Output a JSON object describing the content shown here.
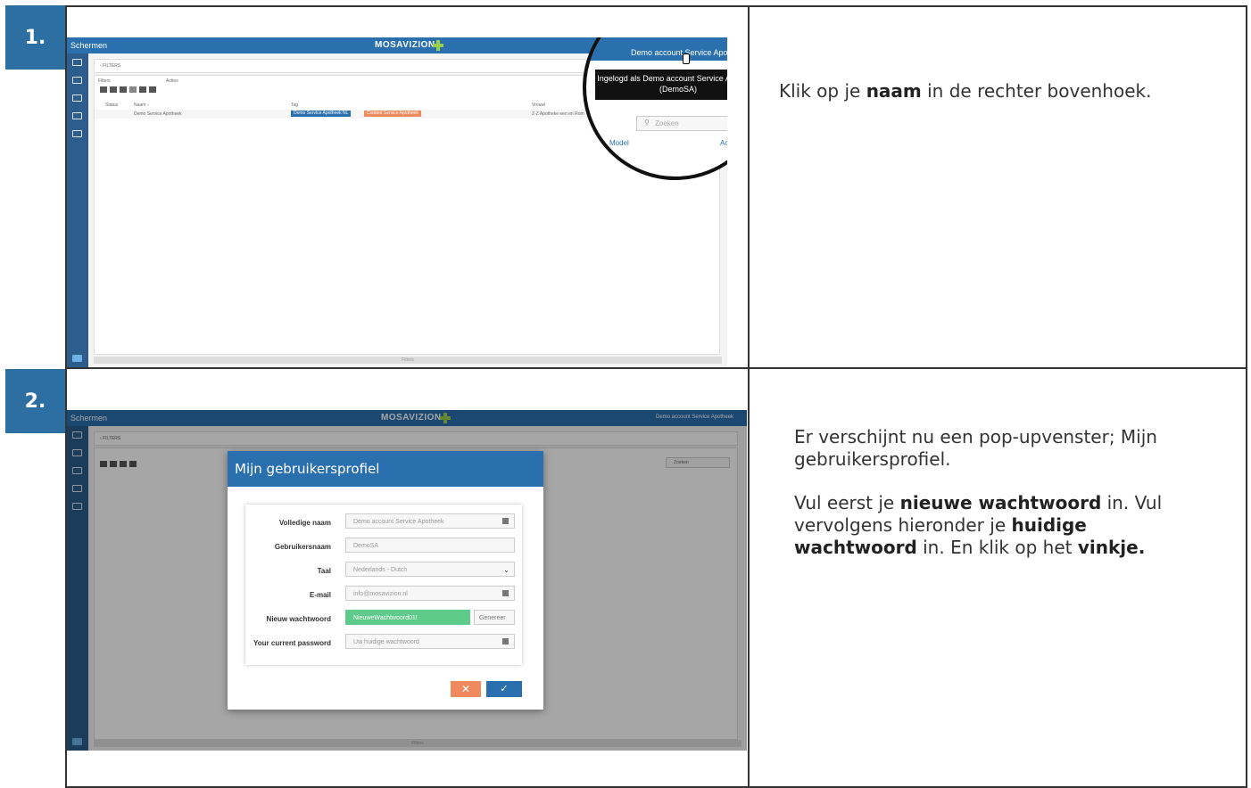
{
  "steps": [
    {
      "number": "1.",
      "description_parts": [
        {
          "text": "Klik op je ",
          "bold": false
        },
        {
          "text": "naam",
          "bold": true
        },
        {
          "text": " in de rechter bovenhoek.",
          "bold": false
        }
      ],
      "screenshot": {
        "app_title": "Schermen",
        "brand": "MOSAVIZION",
        "breadcrumb": "‹ FILTERS",
        "filters_label": "Filters",
        "actions_label": "Acties",
        "columns": [
          "Status",
          "Naam ↓",
          "Tag",
          "Vrouwl"
        ],
        "row": {
          "name": "Demo Service Apotheek",
          "tag1": "Demo Service Apotheek NL",
          "tag2": "Content Service Apotheek",
          "info": "Z-Z Apotheke een en Rom"
        },
        "footer": "Filters",
        "magnifier": {
          "account_name": "Demo account Service Apotheek",
          "tooltip": "Ingelogd als Demo account Service Apotheek (DemoSA)",
          "search_placeholder": "Zoeken",
          "left_link": "Model",
          "right_link": "Acties"
        },
        "accent": "#2a6fae"
      }
    },
    {
      "number": "2.",
      "description_paragraphs": [
        [
          {
            "text": "Er verschijnt nu een pop-upvenster; Mijn gebruikersprofiel.",
            "bold": false
          }
        ],
        [
          {
            "text": "Vul eerst je ",
            "bold": false
          },
          {
            "text": "nieuwe wachtwoord",
            "bold": true
          },
          {
            "text": " in. Vul vervolgens hieronder je ",
            "bold": false
          },
          {
            "text": "huidige wachtwoord",
            "bold": true
          },
          {
            "text": " in. En klik op het ",
            "bold": false
          },
          {
            "text": "vinkje.",
            "bold": true
          }
        ]
      ],
      "screenshot": {
        "app_title": "Schermen",
        "brand": "MOSAVIZION",
        "account_name": "Demo account Service Apotheek",
        "breadcrumb": "‹ FILTERS",
        "search_placeholder": "Zoeken",
        "footer": "Filters",
        "modal": {
          "title": "Mijn gebruikersprofiel",
          "fields": [
            {
              "label": "Volledige naam",
              "value": "Demo account Service Apotheek"
            },
            {
              "label": "Gebruikersnaam",
              "value": "DemoSA"
            },
            {
              "label": "Taal",
              "value": "Nederlands - Dutch"
            },
            {
              "label": "E-mail",
              "value": "info@mosavizion.nl"
            },
            {
              "label": "Nieuw wachtwoord",
              "value": "NieuweWachtwoord01!"
            },
            {
              "label": "Your current password",
              "placeholder": "Uw huidige wachtwoord"
            }
          ],
          "generate_label": "Genereer",
          "cancel_icon": "close-icon",
          "confirm_icon": "check-icon",
          "cancel_color": "#ee8a5e",
          "confirm_color": "#2a6fae",
          "new_password_color": "#5ecb8a"
        }
      }
    }
  ]
}
